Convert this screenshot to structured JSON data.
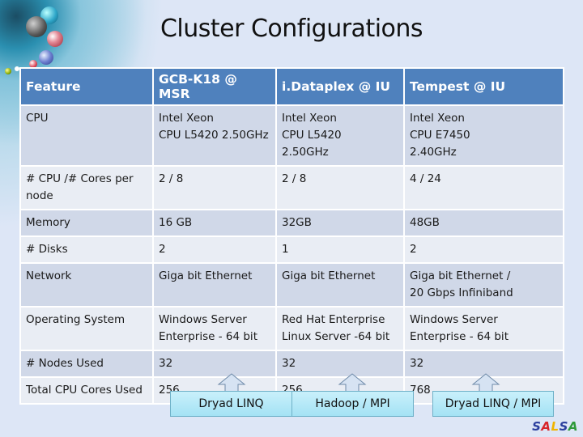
{
  "title": "Cluster Configurations",
  "table": {
    "headers": [
      "Feature",
      "GCB-K18 @ MSR",
      "i.Dataplex @ IU",
      "Tempest @ IU"
    ],
    "rows": [
      {
        "feature": "CPU",
        "values": [
          "Intel Xeon\nCPU L5420  2.50GHz",
          "Intel Xeon\nCPU L5420\n2.50GHz",
          "Intel Xeon\nCPU E7450\n2.40GHz"
        ]
      },
      {
        "feature": "# CPU /# Cores per node",
        "values": [
          "2 / 8",
          "2 / 8",
          "4 / 24"
        ]
      },
      {
        "feature": "Memory",
        "values": [
          "16 GB",
          "32GB",
          "48GB"
        ]
      },
      {
        "feature": "# Disks",
        "values": [
          "2",
          "1",
          "2"
        ]
      },
      {
        "feature": "Network",
        "values": [
          "Giga bit Ethernet",
          "Giga bit Ethernet",
          "Giga bit Ethernet /\n20 Gbps Infiniband"
        ]
      },
      {
        "feature": "Operating System",
        "values": [
          "Windows Server\nEnterprise - 64 bit",
          "Red Hat Enterprise\nLinux Server -64 bit",
          "Windows Server\nEnterprise - 64 bit"
        ]
      },
      {
        "feature": "# Nodes Used",
        "values": [
          "32",
          "32",
          "32"
        ]
      },
      {
        "feature": "Total CPU Cores Used",
        "values": [
          "256",
          "256",
          "768"
        ]
      }
    ]
  },
  "frameworks": [
    "Dryad LINQ",
    "Hadoop / MPI",
    "Dryad LINQ / MPI"
  ],
  "logo": {
    "letters": [
      {
        "ch": "S",
        "color": "#2b3f9e"
      },
      {
        "ch": "A",
        "color": "#d8262b"
      },
      {
        "ch": "L",
        "color": "#f0b400"
      },
      {
        "ch": "S",
        "color": "#2b3f9e"
      },
      {
        "ch": "A",
        "color": "#2f9a3a"
      }
    ]
  },
  "colors": {
    "header_bg": "#4f81bd",
    "row_odd": "#d0d8e8",
    "row_even": "#e9edf4",
    "background": "#dde6f6",
    "framework_box": "#b6e9f7"
  }
}
